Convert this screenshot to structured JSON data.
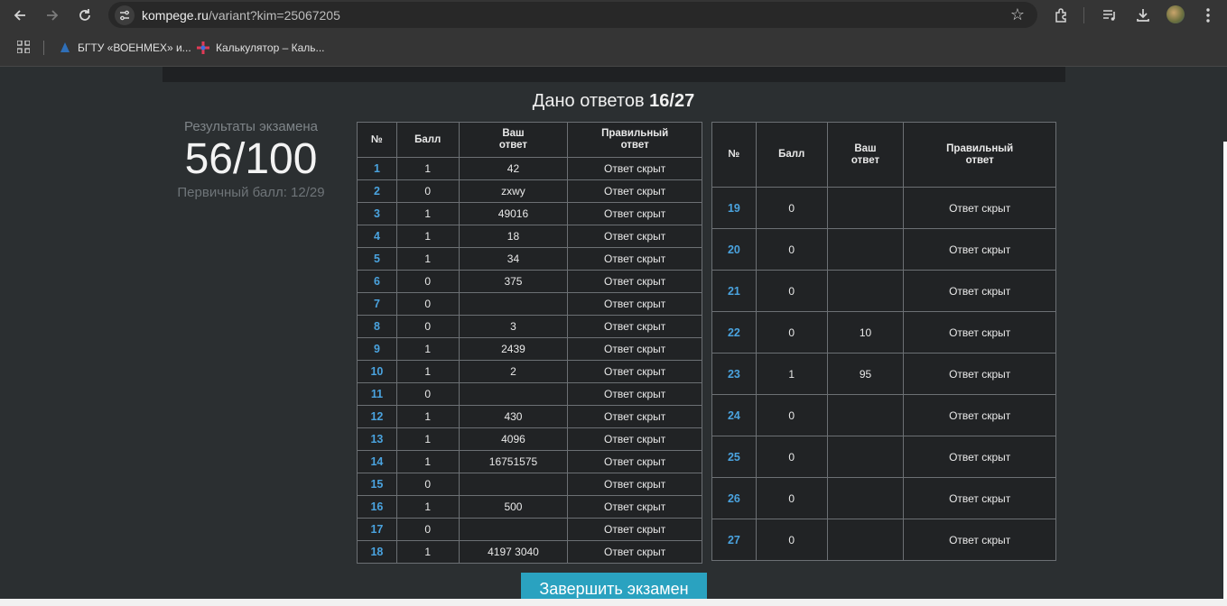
{
  "browser": {
    "url_host": "kompege.ru",
    "url_path": "/variant?kim=25067205",
    "bookmarks": [
      {
        "label": "БГТУ «ВОЕНМЕХ» и..."
      },
      {
        "label": "Калькулятор – Каль..."
      }
    ]
  },
  "page": {
    "given_prefix": "Дано ответов",
    "given_value": "16/27",
    "results_title": "Результаты экзамена",
    "score": "56/100",
    "primary_score": "Первичный балл: 12/29",
    "finish_button": "Завершить экзамен"
  },
  "table": {
    "headers": [
      "№",
      "Балл",
      "Ваш ответ",
      "Правильный ответ"
    ],
    "rows_left": [
      {
        "n": "1",
        "score": "1",
        "answer": "42",
        "correct": "Ответ скрыт"
      },
      {
        "n": "2",
        "score": "0",
        "answer": "zxwy",
        "correct": "Ответ скрыт"
      },
      {
        "n": "3",
        "score": "1",
        "answer": "49016",
        "correct": "Ответ скрыт"
      },
      {
        "n": "4",
        "score": "1",
        "answer": "18",
        "correct": "Ответ скрыт"
      },
      {
        "n": "5",
        "score": "1",
        "answer": "34",
        "correct": "Ответ скрыт"
      },
      {
        "n": "6",
        "score": "0",
        "answer": "375",
        "correct": "Ответ скрыт"
      },
      {
        "n": "7",
        "score": "0",
        "answer": "",
        "correct": "Ответ скрыт"
      },
      {
        "n": "8",
        "score": "0",
        "answer": "3",
        "correct": "Ответ скрыт"
      },
      {
        "n": "9",
        "score": "1",
        "answer": "2439",
        "correct": "Ответ скрыт"
      },
      {
        "n": "10",
        "score": "1",
        "answer": "2",
        "correct": "Ответ скрыт"
      },
      {
        "n": "11",
        "score": "0",
        "answer": "",
        "correct": "Ответ скрыт"
      },
      {
        "n": "12",
        "score": "1",
        "answer": "430",
        "correct": "Ответ скрыт"
      },
      {
        "n": "13",
        "score": "1",
        "answer": "4096",
        "correct": "Ответ скрыт"
      },
      {
        "n": "14",
        "score": "1",
        "answer": "16751575",
        "correct": "Ответ скрыт"
      },
      {
        "n": "15",
        "score": "0",
        "answer": "",
        "correct": "Ответ скрыт"
      },
      {
        "n": "16",
        "score": "1",
        "answer": "500",
        "correct": "Ответ скрыт"
      },
      {
        "n": "17",
        "score": "0",
        "answer": "",
        "correct": "Ответ скрыт"
      },
      {
        "n": "18",
        "score": "1",
        "answer": "4197 3040",
        "correct": "Ответ скрыт"
      }
    ],
    "rows_right": [
      {
        "n": "19",
        "score": "0",
        "answer": "",
        "correct": "Ответ скрыт"
      },
      {
        "n": "20",
        "score": "0",
        "answer": "",
        "correct": "Ответ скрыт"
      },
      {
        "n": "21",
        "score": "0",
        "answer": "",
        "correct": "Ответ скрыт"
      },
      {
        "n": "22",
        "score": "0",
        "answer": "10",
        "correct": "Ответ скрыт"
      },
      {
        "n": "23",
        "score": "1",
        "answer": "95",
        "correct": "Ответ скрыт"
      },
      {
        "n": "24",
        "score": "0",
        "answer": "",
        "correct": "Ответ скрыт"
      },
      {
        "n": "25",
        "score": "0",
        "answer": "",
        "correct": "Ответ скрыт"
      },
      {
        "n": "26",
        "score": "0",
        "answer": "",
        "correct": "Ответ скрыт"
      },
      {
        "n": "27",
        "score": "0",
        "answer": "",
        "correct": "Ответ скрыт"
      }
    ]
  },
  "colors": {
    "accent": "#2aa2c0",
    "task_number": "#4aa3df",
    "background": "#2b2f31"
  },
  "icons": [
    "back-arrow-icon",
    "forward-arrow-icon",
    "reload-icon",
    "site-settings-icon",
    "star-icon",
    "extensions-icon",
    "media-icon",
    "download-icon",
    "menu-icon",
    "apps-grid-icon"
  ]
}
